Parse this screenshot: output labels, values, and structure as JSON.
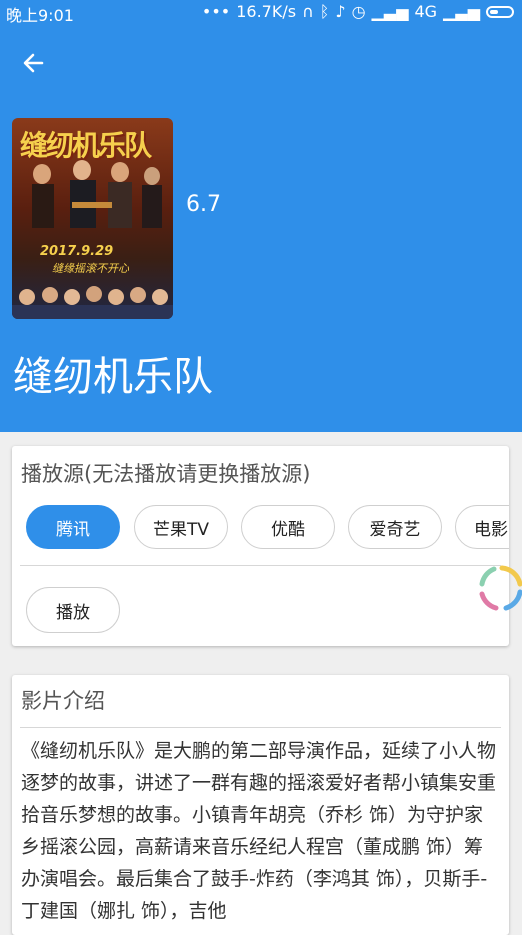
{
  "status_bar": {
    "time": "晚上9:01",
    "dots": "•••",
    "speed": "16.7K/s",
    "network": "4G"
  },
  "movie": {
    "rating": "6.7",
    "title": "缝纫机乐队",
    "poster": {
      "title_art": "缝纫机乐队",
      "date": "2017.9.29",
      "slogan": "缝缘摇滚不开心"
    }
  },
  "sources": {
    "heading": "播放源(无法播放请更换播放源)",
    "items": [
      "腾讯",
      "芒果TV",
      "优酷",
      "爱奇艺",
      "电影"
    ],
    "selected": "腾讯",
    "play_label": "播放"
  },
  "intro": {
    "heading": "影片介绍",
    "text": "《缝纫机乐队》是大鹏的第二部导演作品，延续了小人物逐梦的故事，讲述了一群有趣的摇滚爱好者帮小镇集安重拾音乐梦想的故事。小镇青年胡亮（乔杉 饰）为守护家乡摇滚公园，高薪请来音乐经纪人程宫（董成鹏 饰）筹办演唱会。最后集合了鼓手-炸药（李鸿其 饰），贝斯手-丁建国（娜扎 饰），吉他"
  },
  "colors": {
    "primary": "#2f8fe9",
    "background": "#efefef"
  },
  "icons": {
    "back": "arrow-left-icon",
    "loader": "loading-spinner-icon"
  }
}
